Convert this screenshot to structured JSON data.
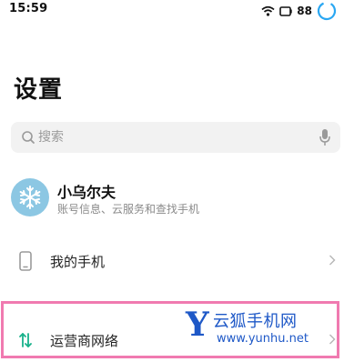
{
  "status_bar": {
    "time": "15:59",
    "battery": "88"
  },
  "header": {
    "title": "设置"
  },
  "search": {
    "placeholder": "搜索",
    "value": ""
  },
  "account": {
    "name": "小乌尔夫",
    "subtitle": "账号信息、云服务和查找手机"
  },
  "items": [
    {
      "label": "我的手机",
      "icon": "phone-icon"
    },
    {
      "label": "运营商网络",
      "icon": "data-transfer-icon"
    }
  ],
  "watermark": {
    "letter": "Y",
    "title": "云狐手机网",
    "url": "www.yunhu.net"
  },
  "colors": {
    "accent": "#2aa7f2",
    "avatar": "#8cc7e3",
    "network_icon": "#17b18a",
    "highlight": "#f07ab0",
    "watermark": "#1e58c7"
  }
}
